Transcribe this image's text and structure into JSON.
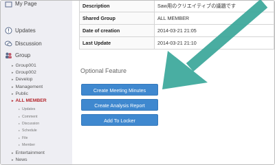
{
  "sidebar": {
    "my_page": "My Page",
    "updates": "Updates",
    "discussion": "Discussion",
    "group": "Group",
    "groups": [
      "Group001",
      "Group002",
      "Develop",
      "Management",
      "Public"
    ],
    "active_group": "ALL MEMBER",
    "active_children": [
      "Updates",
      "Comment",
      "Discussion",
      "Schedule",
      "File",
      "Member"
    ],
    "after": [
      "Entertainment",
      "News"
    ]
  },
  "info_table": {
    "rows": [
      {
        "key": "Description",
        "value": "Saw用のクリエイティブの議題です"
      },
      {
        "key": "Shared Group",
        "value": "ALL MEMBER"
      },
      {
        "key": "Date of creation",
        "value": "2014-03-21 21:05"
      },
      {
        "key": "Last Update",
        "value": "2014-03-21 21:10"
      }
    ]
  },
  "optional": {
    "title": "Optional Feature",
    "buttons": [
      "Create Meeting Minutes",
      "Create Analysis Report",
      "Add To Locker"
    ]
  },
  "colors": {
    "accent_button": "#3f88cf",
    "active_item": "#b4262c",
    "overlay_arrow": "#3aa79a"
  }
}
